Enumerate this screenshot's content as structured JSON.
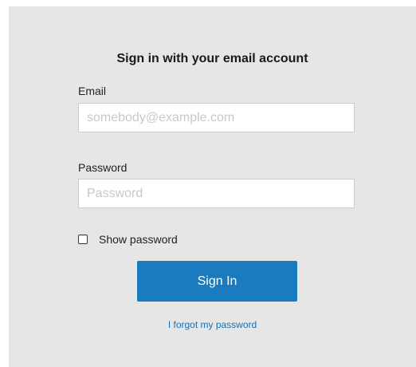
{
  "form": {
    "title": "Sign in with your email account",
    "email_label": "Email",
    "email_placeholder": "somebody@example.com",
    "email_value": "",
    "password_label": "Password",
    "password_placeholder": "Password",
    "password_value": "",
    "show_password_label": "Show password",
    "show_password_checked": false,
    "submit_label": "Sign In",
    "forgot_link": "I forgot my password"
  },
  "colors": {
    "panel_background": "#e6e6e6",
    "button_background": "#1a7bbf",
    "link": "#1a6fb0"
  }
}
